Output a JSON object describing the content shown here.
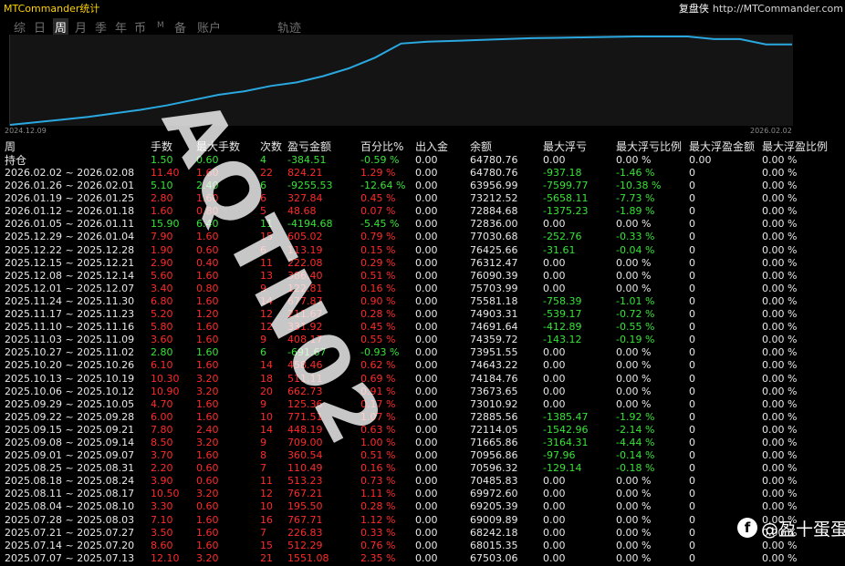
{
  "header": {
    "app_title": "MTCommander统计",
    "brand_name": "复盘侠",
    "brand_url": "http://MTCommander.com"
  },
  "tabs": [
    {
      "label": "综",
      "active": false
    },
    {
      "label": "日",
      "active": false
    },
    {
      "label": "周",
      "active": true
    },
    {
      "label": "月",
      "active": false
    },
    {
      "label": "季",
      "active": false
    },
    {
      "label": "年",
      "active": false
    },
    {
      "label": "币",
      "active": false
    },
    {
      "label": "M",
      "active": false
    },
    {
      "label": "备",
      "active": false
    },
    {
      "label": "账户",
      "active": false
    },
    {
      "label": "轨迹",
      "active": false
    }
  ],
  "chart": {
    "x_start_label": "2024.12.09",
    "x_end_label": "2026.02.02",
    "line_color": "#2aa8e0",
    "chart_data": {
      "type": "line",
      "series": [
        {
          "values": [
            0,
            3,
            6,
            9,
            13,
            17,
            22,
            28,
            34,
            38,
            44,
            48,
            55,
            64,
            76,
            92,
            94,
            95,
            96,
            97,
            98,
            98.5,
            99,
            99.5,
            100,
            100,
            100,
            97,
            97,
            91,
            91
          ]
        }
      ]
    }
  },
  "table": {
    "columns": [
      "周",
      "手数",
      "最大手数",
      "次数",
      "盈亏金额",
      "百分比%",
      "出入金",
      "余额",
      "最大浮亏",
      "最大浮亏比例",
      "最大浮盈金额",
      "最大浮盈比例"
    ],
    "hold_row": {
      "label": "持仓",
      "lots": "1.50",
      "max_lots": "0.60",
      "count": "4",
      "pnl": "-384.51",
      "pct": "-0.59 %",
      "io": "0.00",
      "balance": "64780.76",
      "max_dd": "0.00",
      "max_dd_pct": "0.00 %",
      "max_fp": "0.00",
      "max_fp_pct": "0.00 %"
    },
    "rows": [
      {
        "week": "2026.02.02 ~ 2026.02.08",
        "lots": "11.40",
        "max_lots": "1.60",
        "count": "22",
        "pnl": "824.21",
        "pct": "1.29 %",
        "io": "0.00",
        "balance": "64780.76",
        "max_dd": "-937.18",
        "max_dd_pct": "-1.46 %",
        "max_fp": "0",
        "max_fp_pct": "0.00 %"
      },
      {
        "week": "2026.01.26 ~ 2026.02.01",
        "lots": "5.10",
        "max_lots": "2.40",
        "count": "6",
        "pnl": "-9255.53",
        "pct": "-12.64 %",
        "io": "0.00",
        "balance": "63956.99",
        "max_dd": "-7599.77",
        "max_dd_pct": "-10.38 %",
        "max_fp": "0",
        "max_fp_pct": "0.00 %"
      },
      {
        "week": "2026.01.19 ~ 2026.01.25",
        "lots": "2.80",
        "max_lots": "1.60",
        "count": "6",
        "pnl": "327.84",
        "pct": "0.45 %",
        "io": "0.00",
        "balance": "73212.52",
        "max_dd": "-5658.11",
        "max_dd_pct": "-7.73 %",
        "max_fp": "0",
        "max_fp_pct": "0.00 %"
      },
      {
        "week": "2026.01.12 ~ 2026.01.18",
        "lots": "1.60",
        "max_lots": "0.80",
        "count": "5",
        "pnl": "48.68",
        "pct": "0.07 %",
        "io": "0.00",
        "balance": "72884.68",
        "max_dd": "-1375.23",
        "max_dd_pct": "-1.89 %",
        "max_fp": "0",
        "max_fp_pct": "0.00 %"
      },
      {
        "week": "2026.01.05 ~ 2026.01.11",
        "lots": "15.90",
        "max_lots": "6.40",
        "count": "11",
        "pnl": "-4194.68",
        "pct": "-5.45 %",
        "io": "0.00",
        "balance": "72836.00",
        "max_dd": "0.00",
        "max_dd_pct": "0.00 %",
        "max_fp": "0",
        "max_fp_pct": "0.00 %"
      },
      {
        "week": "2025.12.29 ~ 2026.01.04",
        "lots": "7.90",
        "max_lots": "1.60",
        "count": "15",
        "pnl": "605.02",
        "pct": "0.79 %",
        "io": "0.00",
        "balance": "77030.68",
        "max_dd": "-252.76",
        "max_dd_pct": "-0.33 %",
        "max_fp": "0",
        "max_fp_pct": "0.00 %"
      },
      {
        "week": "2025.12.22 ~ 2025.12.28",
        "lots": "1.90",
        "max_lots": "0.60",
        "count": "6",
        "pnl": "113.19",
        "pct": "0.15 %",
        "io": "0.00",
        "balance": "76425.66",
        "max_dd": "-31.61",
        "max_dd_pct": "-0.04 %",
        "max_fp": "0",
        "max_fp_pct": "0.00 %"
      },
      {
        "week": "2025.12.15 ~ 2025.12.21",
        "lots": "2.90",
        "max_lots": "0.40",
        "count": "11",
        "pnl": "222.08",
        "pct": "0.29 %",
        "io": "0.00",
        "balance": "76312.47",
        "max_dd": "0.00",
        "max_dd_pct": "0.00 %",
        "max_fp": "0",
        "max_fp_pct": "0.00 %"
      },
      {
        "week": "2025.12.08 ~ 2025.12.14",
        "lots": "5.60",
        "max_lots": "1.60",
        "count": "13",
        "pnl": "386.40",
        "pct": "0.51 %",
        "io": "0.00",
        "balance": "76090.39",
        "max_dd": "0.00",
        "max_dd_pct": "0.00 %",
        "max_fp": "0",
        "max_fp_pct": "0.00 %"
      },
      {
        "week": "2025.12.01 ~ 2025.12.07",
        "lots": "3.40",
        "max_lots": "0.80",
        "count": "9",
        "pnl": "122.81",
        "pct": "0.16 %",
        "io": "0.00",
        "balance": "75703.99",
        "max_dd": "0.00",
        "max_dd_pct": "0.00 %",
        "max_fp": "0",
        "max_fp_pct": "0.00 %"
      },
      {
        "week": "2025.11.24 ~ 2025.11.30",
        "lots": "6.80",
        "max_lots": "1.60",
        "count": "14",
        "pnl": "677.87",
        "pct": "0.90 %",
        "io": "0.00",
        "balance": "75581.18",
        "max_dd": "-758.39",
        "max_dd_pct": "-1.01 %",
        "max_fp": "0",
        "max_fp_pct": "0.00 %"
      },
      {
        "week": "2025.11.17 ~ 2025.11.23",
        "lots": "5.20",
        "max_lots": "1.20",
        "count": "12",
        "pnl": "211.67",
        "pct": "0.28 %",
        "io": "0.00",
        "balance": "74903.31",
        "max_dd": "-539.17",
        "max_dd_pct": "-0.72 %",
        "max_fp": "0",
        "max_fp_pct": "0.00 %"
      },
      {
        "week": "2025.11.10 ~ 2025.11.16",
        "lots": "5.80",
        "max_lots": "1.60",
        "count": "12",
        "pnl": "331.92",
        "pct": "0.45 %",
        "io": "0.00",
        "balance": "74691.64",
        "max_dd": "-412.89",
        "max_dd_pct": "-0.55 %",
        "max_fp": "0",
        "max_fp_pct": "0.00 %"
      },
      {
        "week": "2025.11.03 ~ 2025.11.09",
        "lots": "3.60",
        "max_lots": "1.60",
        "count": "9",
        "pnl": "408.17",
        "pct": "0.55 %",
        "io": "0.00",
        "balance": "74359.72",
        "max_dd": "-143.12",
        "max_dd_pct": "-0.19 %",
        "max_fp": "0",
        "max_fp_pct": "0.00 %"
      },
      {
        "week": "2025.10.27 ~ 2025.11.02",
        "lots": "2.80",
        "max_lots": "1.60",
        "count": "6",
        "pnl": "-691.67",
        "pct": "-0.93 %",
        "io": "0.00",
        "balance": "73951.55",
        "max_dd": "0.00",
        "max_dd_pct": "0.00 %",
        "max_fp": "0",
        "max_fp_pct": "0.00 %"
      },
      {
        "week": "2025.10.20 ~ 2025.10.26",
        "lots": "6.10",
        "max_lots": "1.60",
        "count": "14",
        "pnl": "458.46",
        "pct": "0.62 %",
        "io": "0.00",
        "balance": "74643.22",
        "max_dd": "0.00",
        "max_dd_pct": "0.00 %",
        "max_fp": "0",
        "max_fp_pct": "0.00 %"
      },
      {
        "week": "2025.10.13 ~ 2025.10.19",
        "lots": "10.30",
        "max_lots": "3.20",
        "count": "18",
        "pnl": "511.11",
        "pct": "0.69 %",
        "io": "0.00",
        "balance": "74184.76",
        "max_dd": "0.00",
        "max_dd_pct": "0.00 %",
        "max_fp": "0",
        "max_fp_pct": "0.00 %"
      },
      {
        "week": "2025.10.06 ~ 2025.10.12",
        "lots": "10.90",
        "max_lots": "3.20",
        "count": "20",
        "pnl": "662.73",
        "pct": "0.91 %",
        "io": "0.00",
        "balance": "73673.65",
        "max_dd": "0.00",
        "max_dd_pct": "0.00 %",
        "max_fp": "0",
        "max_fp_pct": "0.00 %"
      },
      {
        "week": "2025.09.29 ~ 2025.10.05",
        "lots": "4.70",
        "max_lots": "1.60",
        "count": "9",
        "pnl": "125.36",
        "pct": "0.17 %",
        "io": "0.00",
        "balance": "73010.92",
        "max_dd": "0.00",
        "max_dd_pct": "0.00 %",
        "max_fp": "0",
        "max_fp_pct": "0.00 %"
      },
      {
        "week": "2025.09.22 ~ 2025.09.28",
        "lots": "6.00",
        "max_lots": "1.60",
        "count": "10",
        "pnl": "771.51",
        "pct": "1.07 %",
        "io": "0.00",
        "balance": "72885.56",
        "max_dd": "-1385.47",
        "max_dd_pct": "-1.92 %",
        "max_fp": "0",
        "max_fp_pct": "0.00 %"
      },
      {
        "week": "2025.09.15 ~ 2025.09.21",
        "lots": "7.80",
        "max_lots": "2.40",
        "count": "14",
        "pnl": "448.19",
        "pct": "0.63 %",
        "io": "0.00",
        "balance": "72114.05",
        "max_dd": "-1542.96",
        "max_dd_pct": "-2.14 %",
        "max_fp": "0",
        "max_fp_pct": "0.00 %"
      },
      {
        "week": "2025.09.08 ~ 2025.09.14",
        "lots": "8.50",
        "max_lots": "3.20",
        "count": "9",
        "pnl": "709.00",
        "pct": "1.00 %",
        "io": "0.00",
        "balance": "71665.86",
        "max_dd": "-3164.31",
        "max_dd_pct": "-4.44 %",
        "max_fp": "0",
        "max_fp_pct": "0.00 %"
      },
      {
        "week": "2025.09.01 ~ 2025.09.07",
        "lots": "3.70",
        "max_lots": "1.60",
        "count": "8",
        "pnl": "360.54",
        "pct": "0.51 %",
        "io": "0.00",
        "balance": "70956.86",
        "max_dd": "-97.96",
        "max_dd_pct": "-0.14 %",
        "max_fp": "0",
        "max_fp_pct": "0.00 %"
      },
      {
        "week": "2025.08.25 ~ 2025.08.31",
        "lots": "2.20",
        "max_lots": "0.60",
        "count": "7",
        "pnl": "110.49",
        "pct": "0.16 %",
        "io": "0.00",
        "balance": "70596.32",
        "max_dd": "-129.14",
        "max_dd_pct": "-0.18 %",
        "max_fp": "0",
        "max_fp_pct": "0.00 %"
      },
      {
        "week": "2025.08.18 ~ 2025.08.24",
        "lots": "3.90",
        "max_lots": "0.60",
        "count": "11",
        "pnl": "513.23",
        "pct": "0.73 %",
        "io": "0.00",
        "balance": "70485.83",
        "max_dd": "0.00",
        "max_dd_pct": "0.00 %",
        "max_fp": "0",
        "max_fp_pct": "0.00 %"
      },
      {
        "week": "2025.08.11 ~ 2025.08.17",
        "lots": "10.50",
        "max_lots": "3.20",
        "count": "12",
        "pnl": "767.21",
        "pct": "1.11 %",
        "io": "0.00",
        "balance": "69972.60",
        "max_dd": "0.00",
        "max_dd_pct": "0.00 %",
        "max_fp": "0",
        "max_fp_pct": "0.00 %"
      },
      {
        "week": "2025.08.04 ~ 2025.08.10",
        "lots": "3.30",
        "max_lots": "0.60",
        "count": "10",
        "pnl": "195.50",
        "pct": "0.28 %",
        "io": "0.00",
        "balance": "69205.39",
        "max_dd": "0.00",
        "max_dd_pct": "0.00 %",
        "max_fp": "0",
        "max_fp_pct": "0.00 %"
      },
      {
        "week": "2025.07.28 ~ 2025.08.03",
        "lots": "7.10",
        "max_lots": "1.60",
        "count": "16",
        "pnl": "767.71",
        "pct": "1.12 %",
        "io": "0.00",
        "balance": "69009.89",
        "max_dd": "0.00",
        "max_dd_pct": "0.00 %",
        "max_fp": "0",
        "max_fp_pct": "0.00 %"
      },
      {
        "week": "2025.07.21 ~ 2025.07.27",
        "lots": "3.50",
        "max_lots": "1.60",
        "count": "7",
        "pnl": "226.83",
        "pct": "0.33 %",
        "io": "0.00",
        "balance": "68242.18",
        "max_dd": "0.00",
        "max_dd_pct": "0.00 %",
        "max_fp": "0",
        "max_fp_pct": "0.00 %"
      },
      {
        "week": "2025.07.14 ~ 2025.07.20",
        "lots": "8.60",
        "max_lots": "1.60",
        "count": "15",
        "pnl": "512.29",
        "pct": "0.76 %",
        "io": "0.00",
        "balance": "68015.35",
        "max_dd": "0.00",
        "max_dd_pct": "0.00 %",
        "max_fp": "0",
        "max_fp_pct": "0.00 %"
      },
      {
        "week": "2025.07.07 ~ 2025.07.13",
        "lots": "12.10",
        "max_lots": "3.20",
        "count": "21",
        "pnl": "1551.08",
        "pct": "2.35 %",
        "io": "0.00",
        "balance": "67503.06",
        "max_dd": "0.00",
        "max_dd_pct": "0.00 %",
        "max_fp": "0",
        "max_fp_pct": "0.00 %"
      }
    ]
  },
  "watermark": {
    "text": "AQTN02",
    "source_icon": "facebook-icon",
    "source_name": "@盈十蛋蛋"
  }
}
